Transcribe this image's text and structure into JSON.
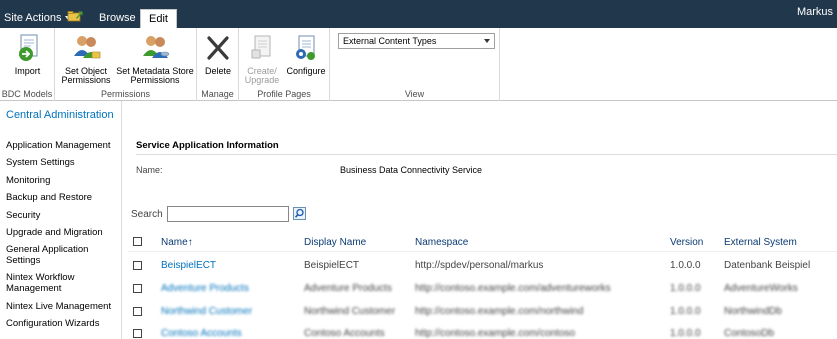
{
  "topbar": {
    "site_actions": "Site Actions",
    "tabs": [
      {
        "label": "Browse"
      },
      {
        "label": "Edit"
      }
    ],
    "user": "Markus"
  },
  "ribbon": {
    "groups": [
      {
        "label": "BDC Models",
        "buttons": [
          {
            "label": "Import"
          }
        ]
      },
      {
        "label": "Permissions",
        "buttons": [
          {
            "label": "Set Object Permissions"
          },
          {
            "label": "Set Metadata Store Permissions"
          }
        ]
      },
      {
        "label": "Manage",
        "buttons": [
          {
            "label": "Delete"
          }
        ]
      },
      {
        "label": "Profile Pages",
        "buttons": [
          {
            "label": "Create/ Upgrade"
          },
          {
            "label": "Configure"
          }
        ]
      },
      {
        "label": "View",
        "select_value": "External Content Types"
      }
    ]
  },
  "leftnav": {
    "title": "Central Administration",
    "items": [
      "Application Management",
      "System Settings",
      "Monitoring",
      "Backup and Restore",
      "Security",
      "Upgrade and Migration",
      "General Application Settings",
      "Nintex Workflow Management",
      "Nintex Live Management",
      "Configuration Wizards"
    ]
  },
  "main": {
    "section_title": "Service Application Information",
    "name_label": "Name:",
    "name_value": "Business Data Connectivity Service",
    "search_label": "Search",
    "columns": [
      "Name",
      "Display Name",
      "Namespace",
      "Version",
      "External System"
    ],
    "sort_indicator": "↑",
    "rows": [
      [
        "BeispielECT",
        "BeispielECT",
        "http://spdev/personal/markus",
        "1.0.0.0",
        "Datenbank Beispiel"
      ],
      [
        "Adventure Products",
        "Adventure Products",
        "http://contoso.example.com/adventureworks",
        "1.0.0.0",
        "AdventureWorks"
      ],
      [
        "Northwind Customer",
        "Northwind Customer",
        "http://contoso.example.com/northwind",
        "1.0.0.0",
        "NorthwindDb"
      ],
      [
        "Contoso Accounts",
        "Contoso Accounts",
        "http://contoso.example.com/contoso",
        "1.0.0.0",
        "ContosoDb"
      ]
    ]
  }
}
